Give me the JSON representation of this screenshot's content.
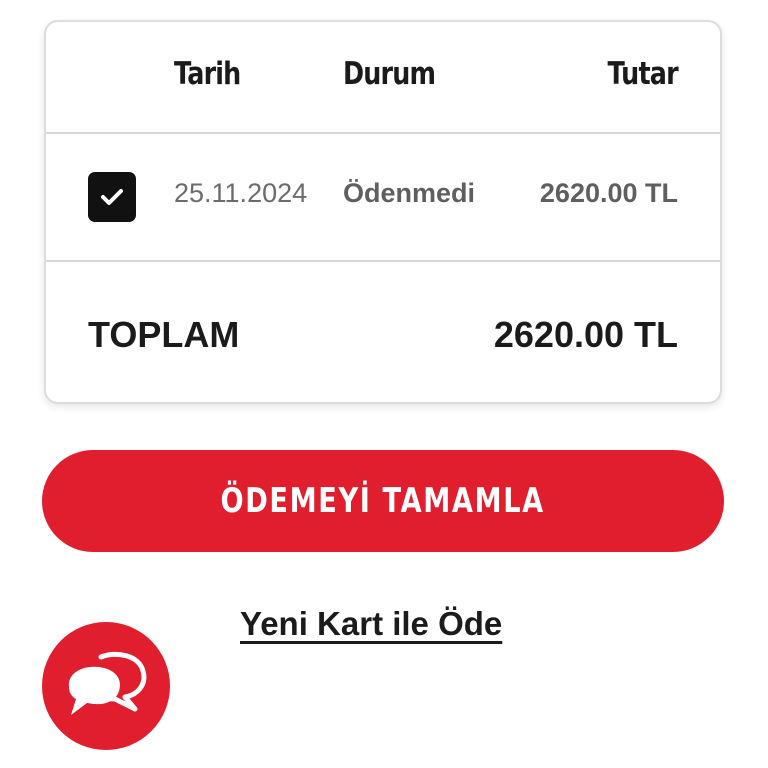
{
  "table": {
    "headers": {
      "date": "Tarih",
      "status": "Durum",
      "amount": "Tutar"
    },
    "rows": [
      {
        "checked": true,
        "date": "25.11.2024",
        "status": "Ödenmedi",
        "amount": "2620.00 TL"
      }
    ],
    "total": {
      "label": "TOPLAM",
      "value": "2620.00 TL"
    }
  },
  "actions": {
    "pay_label": "ÖDEMEYİ TAMAMLA",
    "new_card_label": "Yeni Kart ile Öde"
  },
  "icons": {
    "checkbox": "checkmark-icon",
    "chat": "chat-bubbles-icon"
  },
  "colors": {
    "accent": "#e01e2d",
    "checkbox": "#111111"
  }
}
